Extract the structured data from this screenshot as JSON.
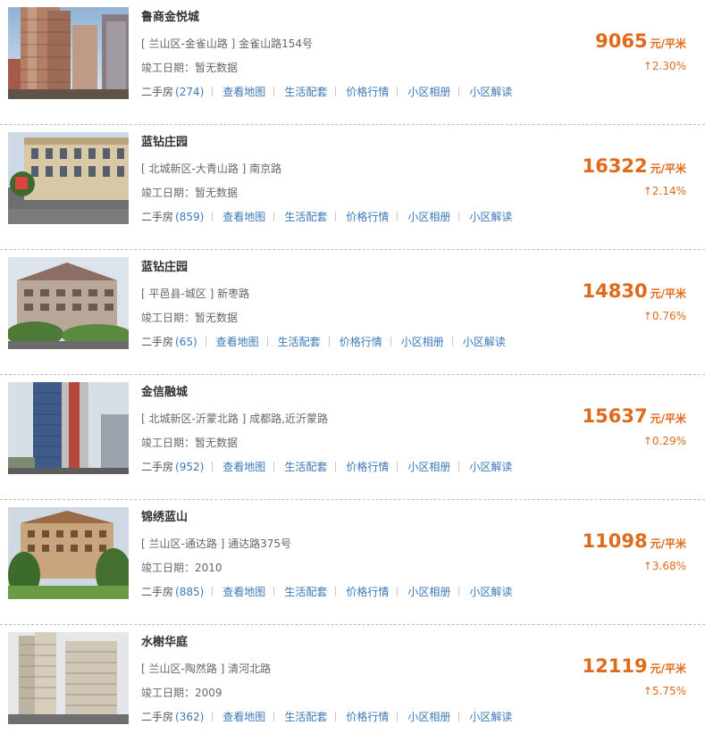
{
  "listings": [
    {
      "name": "鲁商金悦城",
      "address": "[ 兰山区-金雀山路 ] 金雀山路154号",
      "completion": "竣工日期：暂无数据",
      "price": "9065",
      "price_unit": "元/平米",
      "change": "2.30%",
      "trend_icon": "arrow-up-icon",
      "secondhand_label": "二手房",
      "secondhand_count": "(274)",
      "links": [
        "查看地图",
        "生活配套",
        "价格行情",
        "小区相册",
        "小区解读"
      ]
    },
    {
      "name": "蓝钻庄园",
      "address": "[ 北城新区-大青山路 ] 南京路",
      "completion": "竣工日期：暂无数据",
      "price": "16322",
      "price_unit": "元/平米",
      "change": "2.14%",
      "trend_icon": "arrow-up-icon",
      "secondhand_label": "二手房",
      "secondhand_count": "(859)",
      "links": [
        "查看地图",
        "生活配套",
        "价格行情",
        "小区相册",
        "小区解读"
      ]
    },
    {
      "name": "蓝钻庄园",
      "address": "[ 平邑县-城区 ] 新枣路",
      "completion": "竣工日期：暂无数据",
      "price": "14830",
      "price_unit": "元/平米",
      "change": "0.76%",
      "trend_icon": "arrow-up-icon",
      "secondhand_label": "二手房",
      "secondhand_count": "(65)",
      "links": [
        "查看地图",
        "生活配套",
        "价格行情",
        "小区相册",
        "小区解读"
      ]
    },
    {
      "name": "金信融城",
      "address": "[ 北城新区-沂蒙北路 ] 成都路,近沂蒙路",
      "completion": "竣工日期：暂无数据",
      "price": "15637",
      "price_unit": "元/平米",
      "change": "0.29%",
      "trend_icon": "arrow-up-icon",
      "secondhand_label": "二手房",
      "secondhand_count": "(952)",
      "links": [
        "查看地图",
        "生活配套",
        "价格行情",
        "小区相册",
        "小区解读"
      ]
    },
    {
      "name": "锦绣蓝山",
      "address": "[ 兰山区-通达路 ] 通达路375号",
      "completion": "竣工日期：2010",
      "price": "11098",
      "price_unit": "元/平米",
      "change": "3.68%",
      "trend_icon": "arrow-up-icon",
      "secondhand_label": "二手房",
      "secondhand_count": "(885)",
      "links": [
        "查看地图",
        "生活配套",
        "价格行情",
        "小区相册",
        "小区解读"
      ]
    },
    {
      "name": "水榭华庭",
      "address": "[ 兰山区-陶然路 ] 清河北路",
      "completion": "竣工日期：2009",
      "price": "12119",
      "price_unit": "元/平米",
      "change": "5.75%",
      "trend_icon": "arrow-up-icon",
      "secondhand_label": "二手房",
      "secondhand_count": "(362)",
      "links": [
        "查看地图",
        "生活配套",
        "价格行情",
        "小区相册",
        "小区解读"
      ]
    }
  ],
  "colors": {
    "price": "#e06a1b",
    "link": "#3b78b8",
    "title": "#333333",
    "divider": "#bdbdbd"
  }
}
